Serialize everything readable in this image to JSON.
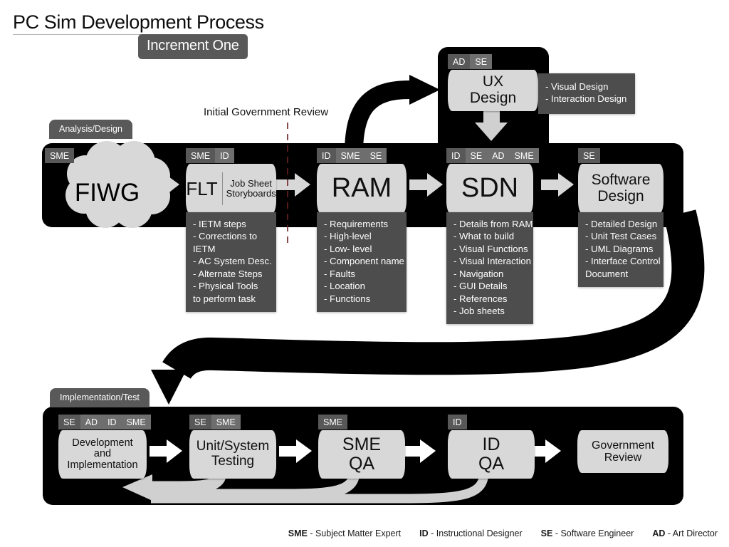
{
  "title": "PC Sim Development Process",
  "subtitle": "Increment One",
  "review_marker": {
    "label": "Initial Government Review"
  },
  "phases": {
    "analysis": {
      "label": "Analysis/Design"
    },
    "implementation": {
      "label": "Implementation/Test"
    }
  },
  "cards": {
    "fiwg": {
      "name": "FIWG",
      "tags": [
        "SME"
      ]
    },
    "flt": {
      "name": "FLT",
      "secondary": "Job Sheet\nStoryboards",
      "tags": [
        "SME",
        "ID"
      ],
      "bullets": [
        "- IETM steps",
        "- Corrections to",
        "  IETM",
        "- AC System Desc.",
        "- Alternate Steps",
        "- Physical Tools",
        "  to perform task"
      ]
    },
    "ram": {
      "name": "RAM",
      "tags": [
        "ID",
        "SME",
        "SE"
      ],
      "bullets": [
        "- Requirements",
        "  - High-level",
        "  - Low- level",
        "- Component name",
        "- Faults",
        "- Location",
        "- Functions"
      ]
    },
    "sdn": {
      "name": "SDN",
      "tags": [
        "ID",
        "SE",
        "AD",
        "SME"
      ],
      "bullets": [
        "- Details from RAM",
        "- What to build",
        "- Visual Functions",
        "- Visual Interaction",
        "- Navigation",
        "- GUI Details",
        "- References",
        "  - Job sheets"
      ]
    },
    "software_design": {
      "name": "Software\nDesign",
      "tags": [
        "SE"
      ],
      "bullets": [
        "- Detailed Design",
        "- Unit Test Cases",
        "- UML Diagrams",
        "- Interface Control",
        "  Document"
      ]
    },
    "ux": {
      "name": "UX\nDesign",
      "tags": [
        "AD",
        "SE"
      ],
      "bullets": [
        "- Visual Design",
        "- Interaction Design"
      ]
    },
    "development": {
      "name": "Development\nand\nImplementation",
      "tags": [
        "SE",
        "AD",
        "ID",
        "SME"
      ]
    },
    "unit_testing": {
      "name": "Unit/System\nTesting",
      "tags": [
        "SE",
        "SME"
      ]
    },
    "sme_qa": {
      "name": "SME\nQA",
      "tags": [
        "SME"
      ]
    },
    "id_qa": {
      "name": "ID\nQA",
      "tags": [
        "ID"
      ]
    },
    "government_review": {
      "name": "Government\nReview",
      "tags": []
    }
  },
  "legend": [
    {
      "abbr": "SME",
      "sep": " - ",
      "text": "Subject Matter Expert"
    },
    {
      "abbr": "ID",
      "sep": " - ",
      "text": "Instructional Designer"
    },
    {
      "abbr": "SE",
      "sep": " - ",
      "text": "Software Engineer"
    },
    {
      "abbr": "AD",
      "sep": " - ",
      "text": "Art Director"
    }
  ],
  "colors": {
    "panel": "#000000",
    "tag_first": "#585858",
    "tag": "#6e6e6e",
    "card": "#d8d8d8",
    "bullets": "#4d4d4d",
    "badge": "#595959",
    "arrow_light": "#d8d8d8",
    "arrow_dark": "#000000"
  }
}
